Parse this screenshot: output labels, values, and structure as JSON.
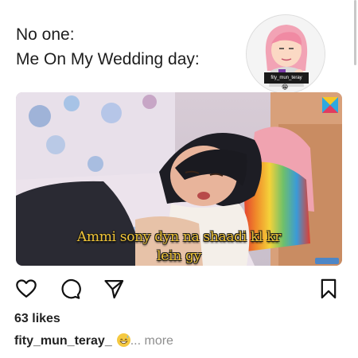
{
  "post": {
    "caption_line1": "No one:",
    "caption_line2": "Me On My Wedding day:",
    "badge_text": "fity_mun_teray",
    "subtitle_line1": "Ammi sony dyn na shaadi kl kr",
    "subtitle_line2": "lein gy"
  },
  "actions": {
    "like_icon": "heart-outline-icon",
    "comment_icon": "comment-bubble-icon",
    "share_icon": "paper-plane-icon",
    "save_icon": "bookmark-icon"
  },
  "meta": {
    "likes": "63 likes",
    "username": "fity_mun_teray_",
    "ellipsis_more": "... more"
  },
  "colors": {
    "subtitle_fill": "#f0c437",
    "subtitle_stroke": "#1a1a1a",
    "icon_stroke": "#111111",
    "muted_text": "#8e8e8e"
  }
}
